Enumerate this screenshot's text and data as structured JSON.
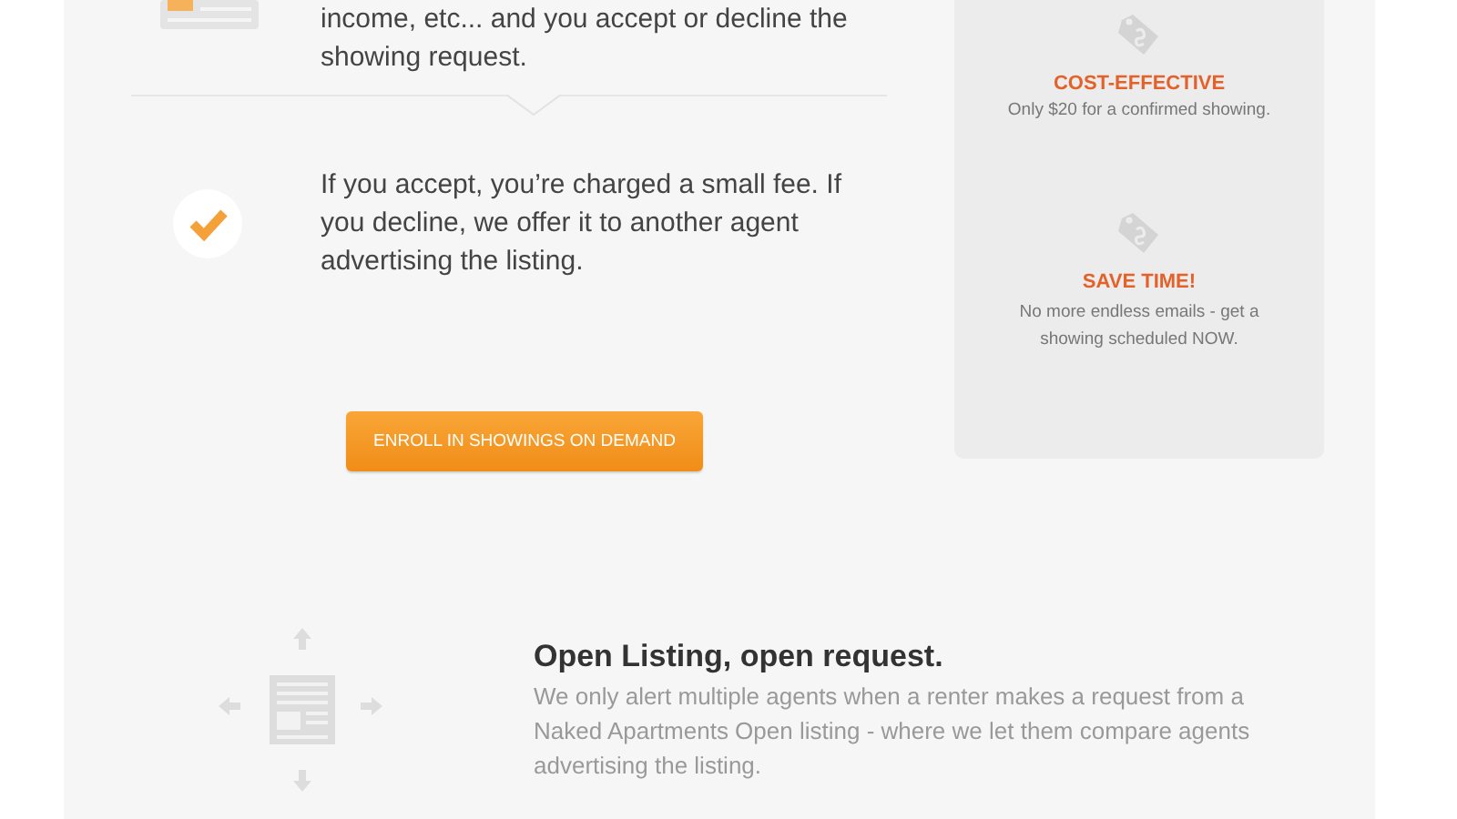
{
  "steps": [
    {
      "kind": "document",
      "text": "income, etc... and you accept or decline the showing request."
    },
    {
      "kind": "check",
      "text": "If you accept, you’re charged a small fee. If you decline, we offer it to another agent advertising the listing."
    }
  ],
  "enroll_button": "ENROLL IN SHOWINGS ON DEMAND",
  "benefits": [
    {
      "title": "COST-EFFECTIVE",
      "text": "Only $20 for a confirmed showing."
    },
    {
      "title": "SAVE TIME!",
      "text": "No more endless emails - get a showing scheduled NOW."
    }
  ],
  "open_listing": {
    "title": "Open Listing, open request.",
    "text": "We only alert multiple agents when a renter makes a request from a Naked Apartments Open listing - where we let them compare agents advertising the listing."
  }
}
